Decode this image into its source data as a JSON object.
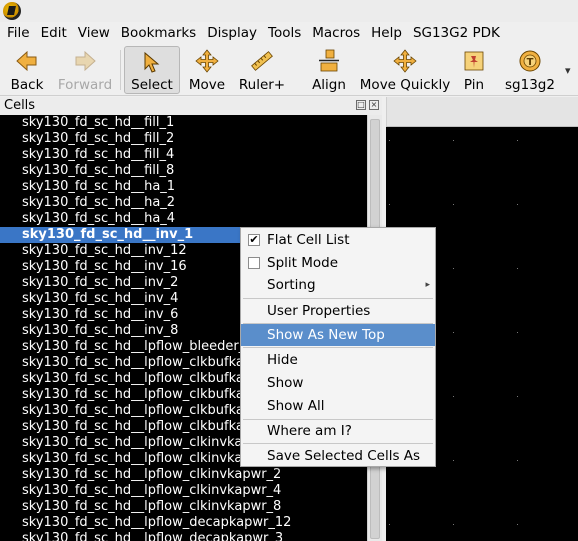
{
  "menubar": {
    "items": [
      "File",
      "Edit",
      "View",
      "Bookmarks",
      "Display",
      "Tools",
      "Macros",
      "Help",
      "SG13G2 PDK"
    ]
  },
  "toolbar": {
    "back": "Back",
    "forward": "Forward",
    "select": "Select",
    "move": "Move",
    "ruler": "Ruler+",
    "align": "Align",
    "move_quickly": "Move Quickly",
    "pin": "Pin",
    "pdk": "sg13g2"
  },
  "cells_panel": {
    "title": "Cells",
    "items": [
      "sky130_fd_sc_hd__fill_1",
      "sky130_fd_sc_hd__fill_2",
      "sky130_fd_sc_hd__fill_4",
      "sky130_fd_sc_hd__fill_8",
      "sky130_fd_sc_hd__ha_1",
      "sky130_fd_sc_hd__ha_2",
      "sky130_fd_sc_hd__ha_4",
      "sky130_fd_sc_hd__inv_1",
      "sky130_fd_sc_hd__inv_12",
      "sky130_fd_sc_hd__inv_16",
      "sky130_fd_sc_hd__inv_2",
      "sky130_fd_sc_hd__inv_4",
      "sky130_fd_sc_hd__inv_6",
      "sky130_fd_sc_hd__inv_8",
      "sky130_fd_sc_hd__lpflow_bleeder_1",
      "sky130_fd_sc_hd__lpflow_clkbufkapwr_1",
      "sky130_fd_sc_hd__lpflow_clkbufkapwr_16",
      "sky130_fd_sc_hd__lpflow_clkbufkapwr_2",
      "sky130_fd_sc_hd__lpflow_clkbufkapwr_4",
      "sky130_fd_sc_hd__lpflow_clkbufkapwr_8",
      "sky130_fd_sc_hd__lpflow_clkinvkapwr_1",
      "sky130_fd_sc_hd__lpflow_clkinvkapwr_16",
      "sky130_fd_sc_hd__lpflow_clkinvkapwr_2",
      "sky130_fd_sc_hd__lpflow_clkinvkapwr_4",
      "sky130_fd_sc_hd__lpflow_clkinvkapwr_8",
      "sky130_fd_sc_hd__lpflow_decapkapwr_12",
      "sky130_fd_sc_hd__lpflow_decapkapwr_3"
    ],
    "selected_index": 7
  },
  "context_menu": {
    "flat_cell_list": "Flat Cell List",
    "split_mode": "Split Mode",
    "sorting": "Sorting",
    "user_properties": "User Properties",
    "show_as_new_top": "Show As New Top",
    "hide": "Hide",
    "show": "Show",
    "show_all": "Show All",
    "where_am_i": "Where am I?",
    "show_selected_cells_as": "Save Selected Cells As",
    "flat_cell_list_checked": true,
    "split_mode_checked": false
  },
  "colors": {
    "selection": "#3a76c6",
    "menu_highlight": "#5a8ecb",
    "list_background": "#000000"
  }
}
